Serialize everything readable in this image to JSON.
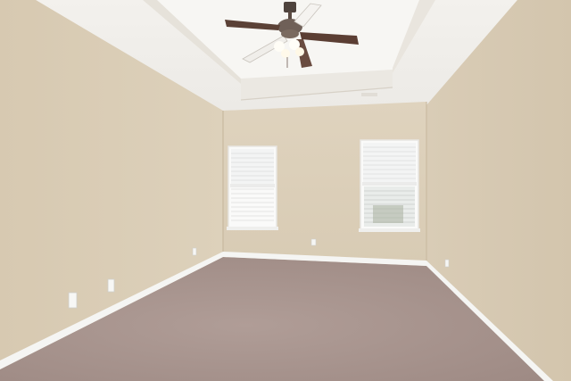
{
  "scene": {
    "room": "empty-bedroom",
    "fixtures": [
      "ceiling-fan",
      "light-kit",
      "window-left",
      "window-right",
      "outlets"
    ],
    "colors": {
      "wall": "#dccfb9",
      "wall_shadow": "#cdbfa6",
      "ceiling": "#f4f2ee",
      "trim": "#f6f6f4",
      "carpet": "#a99690",
      "carpet_dark": "#9c8882",
      "fan_metal": "#6b5b52",
      "fan_blade": "#5a3f35",
      "window_light": "#f7f8f8"
    }
  }
}
